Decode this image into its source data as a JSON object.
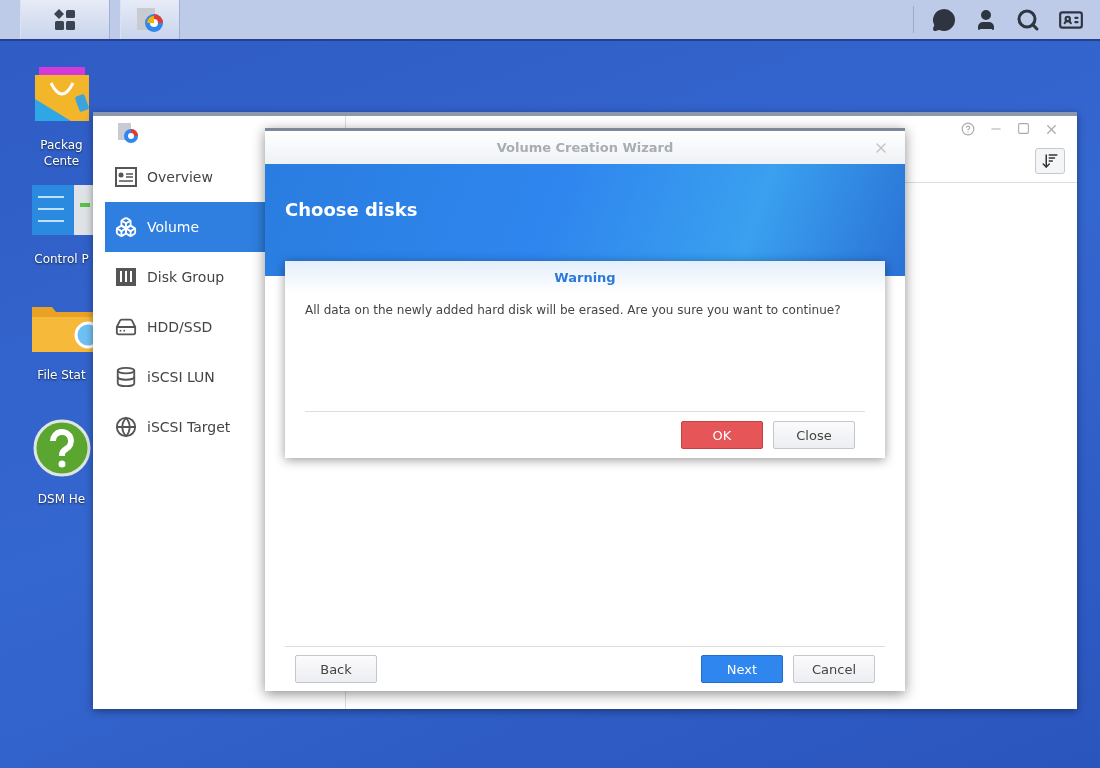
{
  "desktop_icons": [
    {
      "kind": "package",
      "lines": [
        "Packag",
        "Cente"
      ]
    },
    {
      "kind": "control",
      "lines": [
        "Control P"
      ]
    },
    {
      "kind": "folder",
      "lines": [
        "File Stat"
      ]
    },
    {
      "kind": "help",
      "lines": [
        "DSM He"
      ]
    }
  ],
  "storage_manager": {
    "sidebar": [
      {
        "label": "Overview",
        "kind": "overview",
        "selected": false
      },
      {
        "label": "Volume",
        "kind": "volume",
        "selected": true
      },
      {
        "label": "Disk Group",
        "kind": "diskgroup",
        "selected": false
      },
      {
        "label": "HDD/SSD",
        "kind": "hdd",
        "selected": false
      },
      {
        "label": "iSCSI LUN",
        "kind": "lun",
        "selected": false
      },
      {
        "label": "iSCSI Target",
        "kind": "target",
        "selected": false
      }
    ]
  },
  "wizard": {
    "title": "Volume Creation Wizard",
    "heading": "Choose disks",
    "buttons": [
      {
        "label": "Back",
        "kind": "default"
      },
      {
        "label": "Next",
        "kind": "primary"
      },
      {
        "label": "Cancel",
        "kind": "default"
      }
    ]
  },
  "warning": {
    "title": "Warning",
    "message": "All data on the newly added hard disk will be erased. Are you sure you want to continue?",
    "buttons": [
      {
        "label": "OK",
        "kind": "danger"
      },
      {
        "label": "Close",
        "kind": "default"
      }
    ]
  }
}
